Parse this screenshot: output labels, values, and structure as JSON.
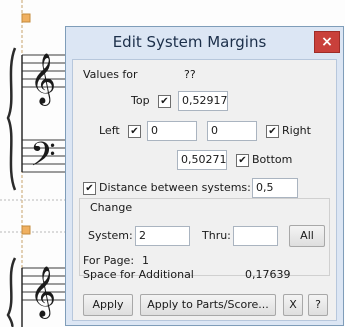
{
  "dialog": {
    "title": "Edit System Margins",
    "close_glyph": "×",
    "values_for_label": "Values for",
    "values_for_value": "??",
    "top_label": "Top",
    "top_checked": true,
    "top_value": "0,52917",
    "left_label": "Left",
    "left_checked": true,
    "left_value": "0",
    "right_value": "0",
    "right_label": "Right",
    "right_checked": true,
    "bottom_value": "0,50271",
    "bottom_label": "Bottom",
    "bottom_checked": true,
    "distance_label": "Distance between systems:",
    "distance_checked": true,
    "distance_value": "0,5",
    "change_group_label": "Change",
    "system_label": "System:",
    "system_value": "2",
    "thru_label": "Thru:",
    "thru_value": "",
    "all_button": "All",
    "for_page_label": "For Page:",
    "for_page_value": "1",
    "space_label": "Space for Additional",
    "space_value": "0,17639",
    "apply_button": "Apply",
    "apply_parts_button": "Apply to Parts/Score...",
    "x_button": "X",
    "help_button": "?"
  },
  "colors": {
    "dialog_frame": "#dce6f4",
    "close_button": "#c9403b",
    "staff_selection": "#f0b060"
  },
  "icons": {
    "checkmark": "✔"
  }
}
